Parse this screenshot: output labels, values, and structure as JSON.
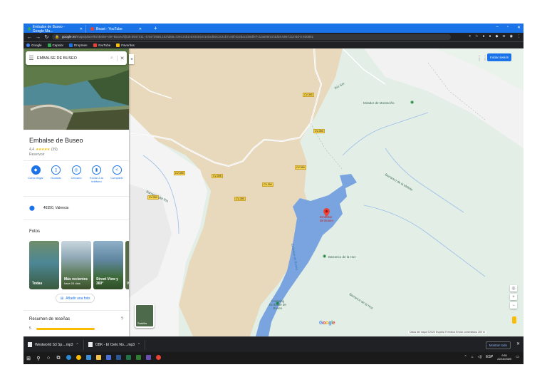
{
  "browser": {
    "tabs": [
      {
        "title": "Embalse de Buseo - Google Ma..."
      },
      {
        "title": "Beast - YouTube"
      }
    ],
    "url_host": "google.es",
    "url_path": "/maps/place/Embalse+de+Buseo/@39.5947211,-0.9473658,15z/data=!3m1!4b1!4m5!3m4!1s0xd60c3c2cb7c49f:0x2dac1b6dfe7c10a8!8m2!3d39.5947212!4d-0.930851",
    "bookmarks": [
      {
        "label": "Google",
        "color": "#4285f4"
      },
      {
        "label": "Capsior",
        "color": "#34a853"
      },
      {
        "label": "Dropmen",
        "color": "#1a73e8"
      },
      {
        "label": "YouTube",
        "color": "#ea4335"
      },
      {
        "label": "Favoritos",
        "color": "#fbbc04"
      }
    ]
  },
  "sidebar": {
    "search_value": "EMBALSE DE BUSEO",
    "place_name": "Embalse de Buseo",
    "rating_value": "4,4",
    "stars": "★★★★★",
    "review_count": "(39)",
    "category": "Reservoir",
    "actions": [
      {
        "label": "Cómo llegar",
        "icon": "directions-icon"
      },
      {
        "label": "Guardar",
        "icon": "bookmark-icon"
      },
      {
        "label": "Cercano",
        "icon": "nearby-icon"
      },
      {
        "label": "Enviar a tu teléfono",
        "icon": "send-to-phone-icon"
      },
      {
        "label": "Compartir",
        "icon": "share-icon"
      }
    ],
    "address": "46350, Valencia",
    "photos_title": "Fotos",
    "photos": [
      {
        "caption": "Todas",
        "sub": ""
      },
      {
        "caption": "Más recientes",
        "sub": "hace 24 días"
      },
      {
        "caption": "Street View y 360°",
        "sub": ""
      },
      {
        "caption": "V",
        "sub": ""
      }
    ],
    "add_photo": "Añadir una foto",
    "reviews_title": "Resumen de reseñas",
    "reviews_first": "5"
  },
  "map": {
    "apps_icon": "apps-grid-icon",
    "sign_in": "Iniciar sesión",
    "labels": {
      "mirador": "Mirador de Monteciño",
      "barranco1": "Barranco de la Moleta",
      "barranco2": "Barranco de la Hoz",
      "barranco3": "Barranco de la Hoz",
      "embalse": "Embalse de Buseo",
      "rio_turia": "Embalse de Buseo",
      "camping": "Camping Embalse de Buseo",
      "rio_sot": "Río Sot",
      "rambla": "Barranco del Río",
      "barranco_hoz_poi": "Barranco de la Hoz"
    },
    "road_tags": [
      "CV-390",
      "CV-390",
      "CV-390",
      "CV-390",
      "CV-390",
      "CV-395"
    ],
    "layer_label": "Satélite",
    "google_logo": "Google",
    "attribution": "Datos del mapa ©2020   España   Términos   Enviar comentarios   200 m"
  },
  "downloads": [
    {
      "name": "Westworld S3 Sp....mp3"
    },
    {
      "name": "OBK - El Cielo No....mp3"
    }
  ],
  "downloads_show_all": "Mostrar todo",
  "taskbar": {
    "time": "9:51",
    "date": "22/10/2020",
    "lang": "ESP"
  }
}
